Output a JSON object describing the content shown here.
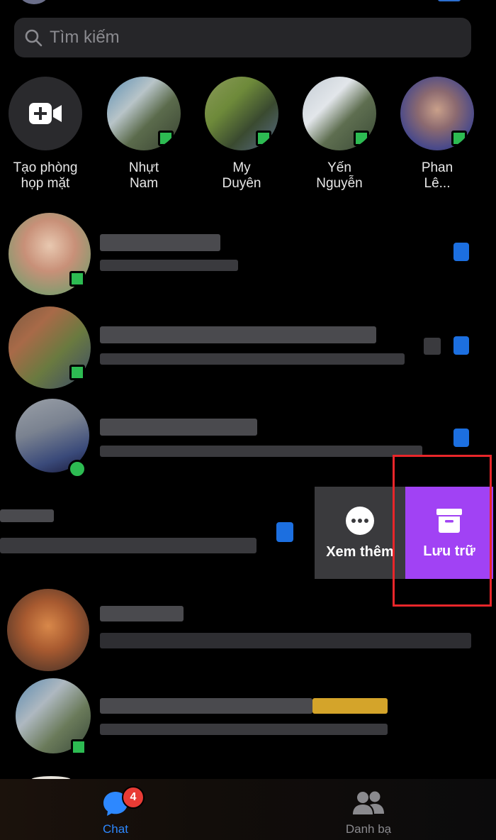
{
  "search": {
    "placeholder": "Tìm kiếm"
  },
  "stories": [
    {
      "name_line1": "Tạo phòng",
      "name_line2": "họp mặt"
    },
    {
      "name_line1": "Nhựt",
      "name_line2": "Nam"
    },
    {
      "name_line1": "My",
      "name_line2": "Duyên"
    },
    {
      "name_line1": "Yến",
      "name_line2": "Nguyễn"
    },
    {
      "name_line1": "Phan",
      "name_line2": "Lê..."
    }
  ],
  "swipe_actions": {
    "more_label": "Xem thêm",
    "archive_label": "Lưu trữ",
    "archive_color": "#a142f4"
  },
  "tabbar": {
    "chat_label": "Chat",
    "chat_badge": "4",
    "contacts_label": "Danh bạ",
    "active_color": "#2d88ff"
  },
  "icons": {
    "search": "search-icon",
    "create_room": "video-plus-icon",
    "more": "ellipsis-circle-icon",
    "archive": "archive-box-icon",
    "chat": "chat-bubble-icon",
    "contacts": "people-icon"
  }
}
